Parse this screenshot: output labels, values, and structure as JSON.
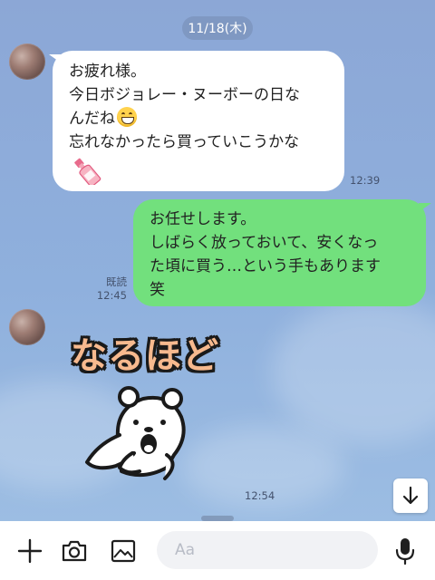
{
  "chat": {
    "date_label": "11/18(木)",
    "messages": [
      {
        "side": "incoming",
        "lines": [
          "お疲れ様。",
          "今日ボジョレー・ヌーボーの日な",
          "んだね",
          "忘れなかったら買っていこうかな"
        ],
        "emoji_after_line3": "grinning-face",
        "attached_emoji": "wine-bottle",
        "time": "12:39"
      },
      {
        "side": "outgoing",
        "lines": [
          "お任せします。",
          "しばらく放っておいて、安くなっ",
          "た頃に買う…という手もあります",
          "笑"
        ],
        "read_label": "既読",
        "time": "12:45"
      },
      {
        "side": "incoming",
        "type": "sticker",
        "sticker_text": "なるほど",
        "sticker_character": "surprised-white-bear",
        "time": "12:54"
      }
    ]
  },
  "input_bar": {
    "placeholder": "Aa",
    "buttons": [
      "plus-icon",
      "camera-icon",
      "image-icon",
      "emoji-icon",
      "microphone-icon"
    ]
  },
  "colors": {
    "background": "#8ca7d6",
    "outgoing_bubble": "#72e07d",
    "incoming_bubble": "#ffffff",
    "date_pill": "#7f98c2"
  }
}
